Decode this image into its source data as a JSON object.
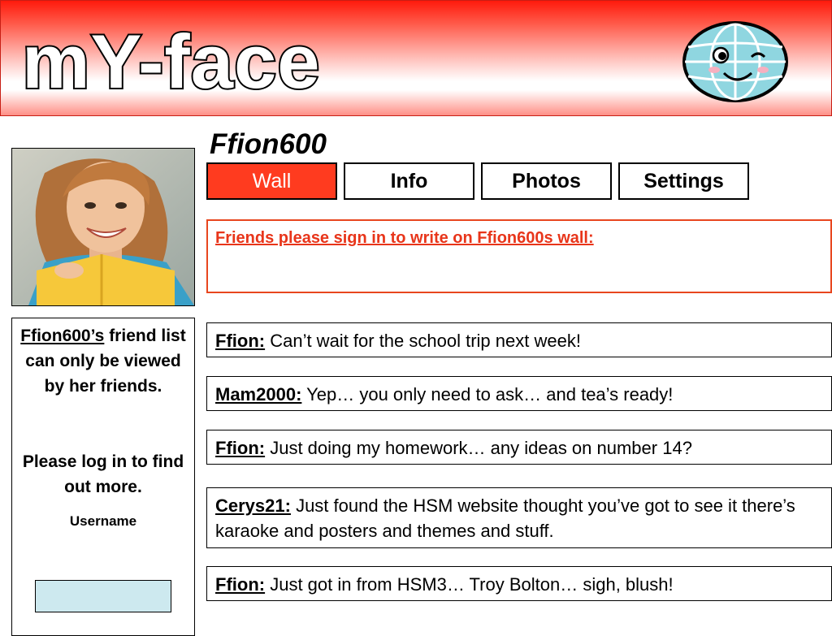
{
  "header": {
    "logo_text": "mY-face",
    "mascot_icon": "smiling-globe-icon"
  },
  "profile": {
    "name": "Ffion600",
    "photo_alt": "profile photo"
  },
  "tabs": [
    {
      "label": "Wall",
      "active": true
    },
    {
      "label": "Info",
      "active": false
    },
    {
      "label": "Photos",
      "active": false
    },
    {
      "label": "Settings",
      "active": false
    }
  ],
  "friend_panel": {
    "owner": "Ffion600’s",
    "message_rest": " friend list can only be viewed by her friends.",
    "login_message": "Please log in to find out more.",
    "username_label": "Username",
    "username_value": ""
  },
  "wall": {
    "sign_in_prompt": "Friends please sign in to write on Ffion600s wall:",
    "posts": [
      {
        "author": "Ffion:",
        "text": " Can’t wait for the school trip next week!"
      },
      {
        "author": "Mam2000:",
        "text": " Yep… you only need to ask… and tea’s ready!"
      },
      {
        "author": "Ffion:",
        "text": " Just doing my homework… any ideas on number 14?"
      },
      {
        "author": "Cerys21:",
        "text": " Just found the HSM website thought you’ve got to see it there’s  karaoke and posters and themes and stuff."
      },
      {
        "author": "Ffion:",
        "text": " Just got in from HSM3… Troy Bolton… sigh, blush!"
      }
    ]
  },
  "colors": {
    "accent": "#ff3b1f",
    "header_red": "#ff1a0c",
    "prompt_red": "#e8351a",
    "input_bg": "#cde9ef",
    "globe_blue": "#8fd6e0"
  }
}
